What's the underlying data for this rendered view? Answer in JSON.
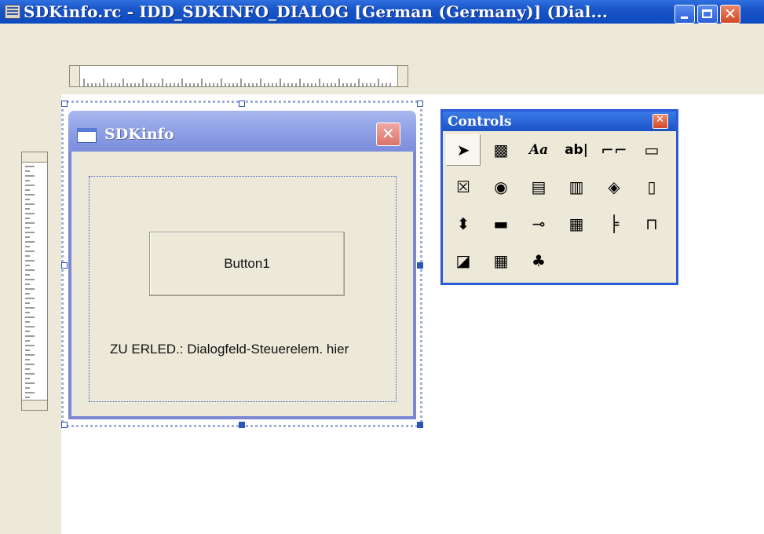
{
  "window": {
    "title": "SDKinfo.rc - IDD_SDKINFO_DIALOG [German (Germany)] (Dial..."
  },
  "dialog": {
    "title": "SDKinfo",
    "button_label": "Button1",
    "static_text": "ZU ERLED.: Dialogfeld-Steuerelem. hier"
  },
  "toolbox": {
    "title": "Controls",
    "tools": [
      {
        "icon": "pointer-icon",
        "glyph": "➤"
      },
      {
        "icon": "picture-icon",
        "glyph": "▩"
      },
      {
        "icon": "static-text-icon",
        "glyph": "Aa"
      },
      {
        "icon": "edit-box-icon",
        "glyph": "ab|"
      },
      {
        "icon": "group-box-icon",
        "glyph": "⌐⌐"
      },
      {
        "icon": "button-icon",
        "glyph": "▭"
      },
      {
        "icon": "check-box-icon",
        "glyph": "☒"
      },
      {
        "icon": "radio-button-icon",
        "glyph": "◉"
      },
      {
        "icon": "combo-box-icon",
        "glyph": "▤"
      },
      {
        "icon": "list-box-icon",
        "glyph": "▥"
      },
      {
        "icon": "horizontal-scroll-icon",
        "glyph": "◈"
      },
      {
        "icon": "vertical-scroll-icon",
        "glyph": "▯"
      },
      {
        "icon": "spin-icon",
        "glyph": "⬍"
      },
      {
        "icon": "progress-icon",
        "glyph": "▬"
      },
      {
        "icon": "slider-icon",
        "glyph": "⊸"
      },
      {
        "icon": "hot-key-icon",
        "glyph": "▦"
      },
      {
        "icon": "list-control-icon",
        "glyph": "╞"
      },
      {
        "icon": "tab-control-icon",
        "glyph": "⊓"
      },
      {
        "icon": "animation-icon",
        "glyph": "◪"
      },
      {
        "icon": "rich-edit-icon",
        "glyph": "▦"
      },
      {
        "icon": "custom-control-icon",
        "glyph": "♣"
      }
    ]
  },
  "colors": {
    "titlebar": "#1a55c8",
    "dialog_frame": "#7b87d2",
    "face": "#ece9d8",
    "selection_handle": "#2a56b8"
  }
}
